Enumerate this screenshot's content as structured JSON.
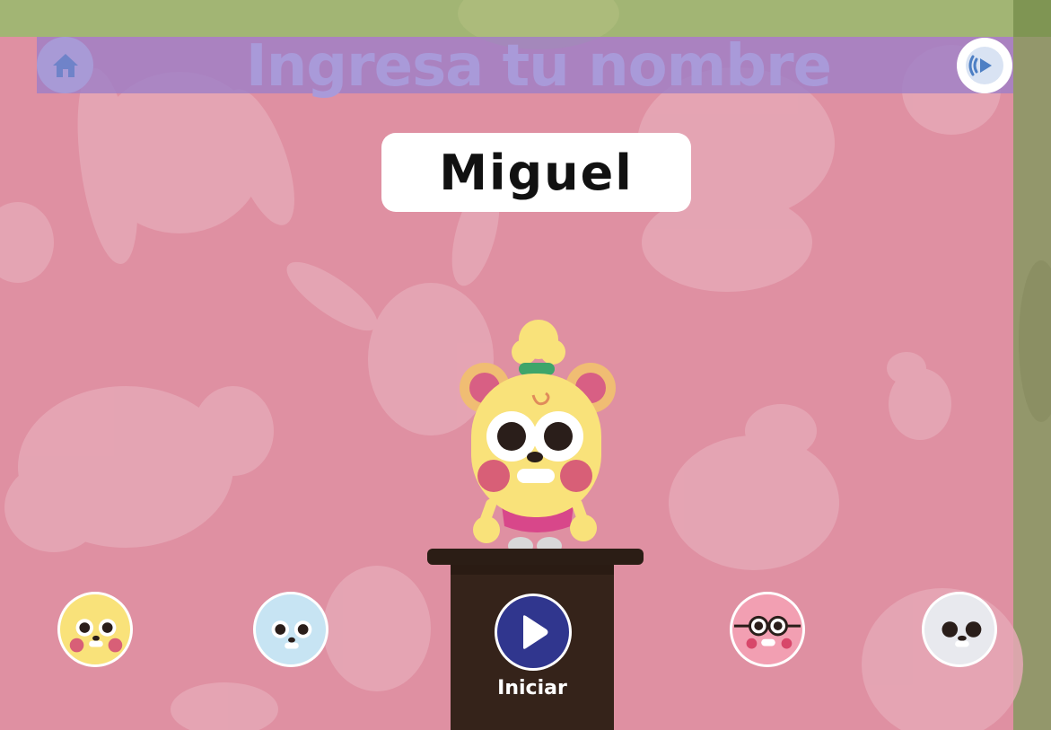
{
  "header": {
    "title": "Ingresa tu nombre",
    "home_icon": "home-icon",
    "audio_icon": "speaker-icon"
  },
  "name_field": {
    "value": "Miguel"
  },
  "start": {
    "label": "Iniciar",
    "icon": "play-icon"
  },
  "characters": [
    {
      "name": "yellow-bear",
      "color": "#f9e27a"
    },
    {
      "name": "blue-bunny",
      "color": "#c7e4f3"
    },
    {
      "name": "pink-glasses",
      "color": "#f29fb2"
    },
    {
      "name": "white-cat",
      "color": "#e8e9ee"
    }
  ],
  "colors": {
    "background": "#df90a2",
    "accent": "#30368e",
    "header_bar": "#9b7dc8",
    "podium": "#35231a",
    "side_strip": "#93976b"
  }
}
